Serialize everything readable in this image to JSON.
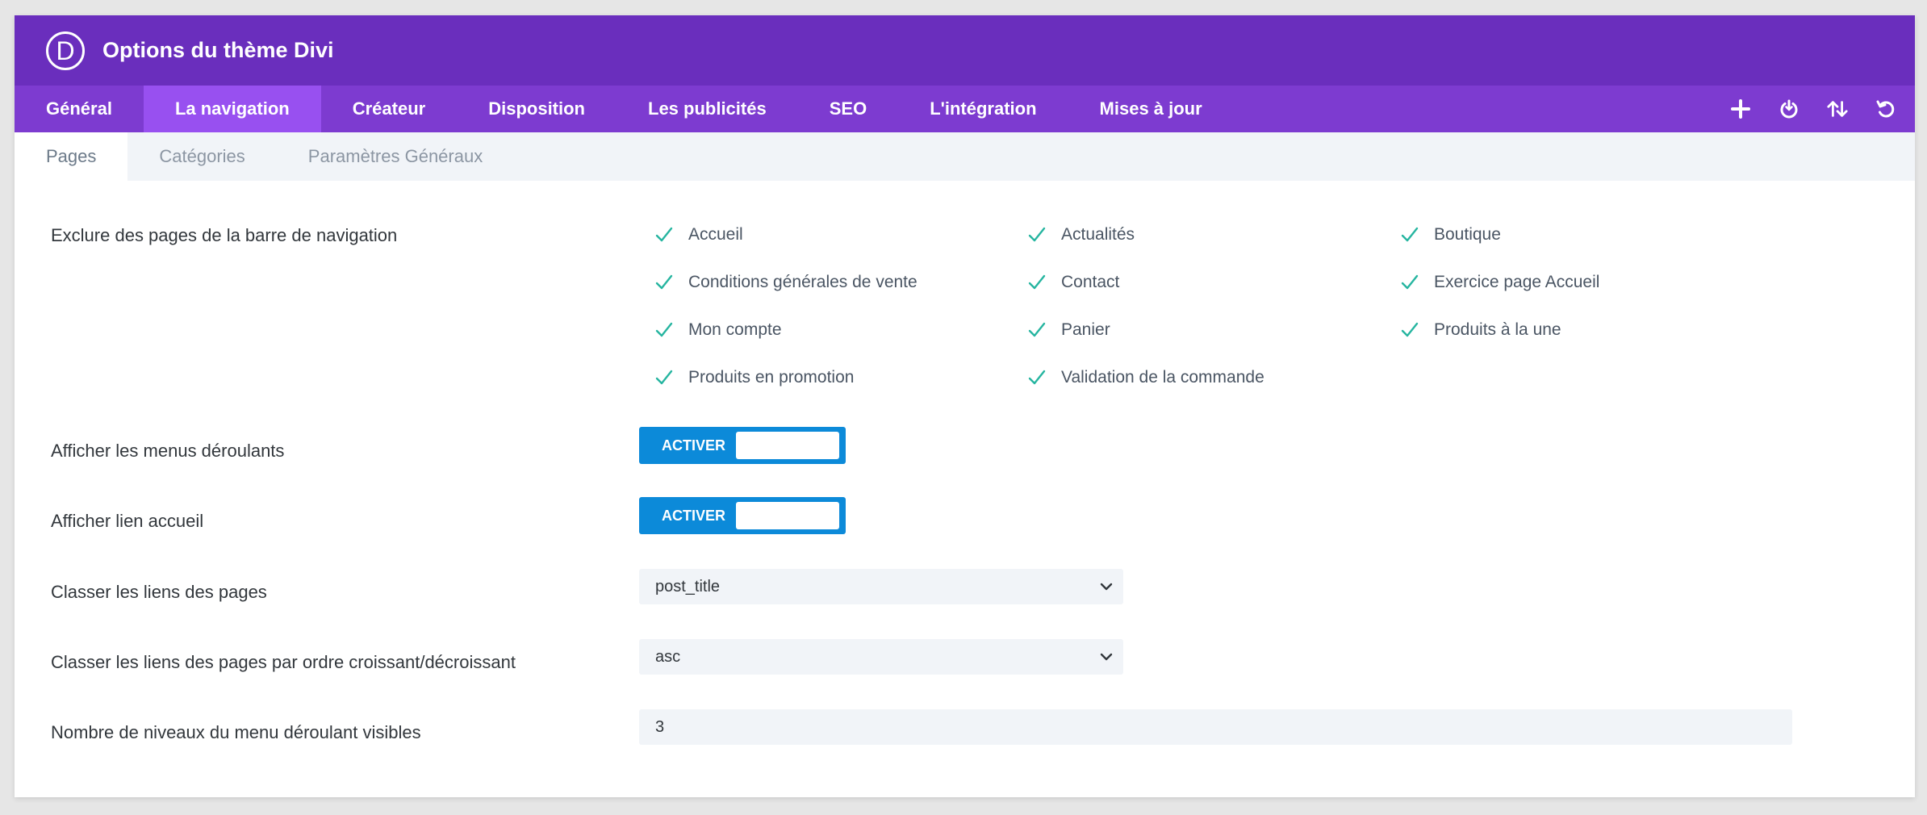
{
  "header": {
    "logo_letter": "D",
    "title": "Options du thème Divi"
  },
  "main_tabs": [
    {
      "label": "Général",
      "active": false
    },
    {
      "label": "La navigation",
      "active": true
    },
    {
      "label": "Créateur",
      "active": false
    },
    {
      "label": "Disposition",
      "active": false
    },
    {
      "label": "Les publicités",
      "active": false
    },
    {
      "label": "SEO",
      "active": false
    },
    {
      "label": "L'intégration",
      "active": false
    },
    {
      "label": "Mises à jour",
      "active": false
    }
  ],
  "toolbar_icons": [
    "plus-icon",
    "power-icon",
    "sort-arrows-icon",
    "undo-icon"
  ],
  "sub_tabs": [
    {
      "label": "Pages",
      "active": true
    },
    {
      "label": "Catégories",
      "active": false
    },
    {
      "label": "Paramètres Généraux",
      "active": false
    }
  ],
  "settings": {
    "exclude_pages": {
      "label": "Exclure des pages de la barre de navigation",
      "pages": [
        "Accueil",
        "Actualités",
        "Boutique",
        "Conditions générales de vente",
        "Contact",
        "Exercice page Accueil",
        "Mon compte",
        "Panier",
        "Produits à la une",
        "Produits en promotion",
        "Validation de la commande"
      ]
    },
    "dropdown_menus": {
      "label": "Afficher les menus déroulants",
      "toggle_label": "ACTIVER"
    },
    "home_link": {
      "label": "Afficher lien accueil",
      "toggle_label": "ACTIVER"
    },
    "sort_pages": {
      "label": "Classer les liens des pages",
      "value": "post_title"
    },
    "sort_order": {
      "label": "Classer les liens des pages par ordre croissant/décroissant",
      "value": "asc"
    },
    "menu_depth": {
      "label": "Nombre de niveaux du menu déroulant visibles",
      "value": "3"
    }
  },
  "colors": {
    "header_bg": "#6a2ebd",
    "nav_bg": "#7d3bd0",
    "nav_active_bg": "#9850f0",
    "check_color": "#26b5a0",
    "toggle_bg": "#0c8ad9"
  }
}
